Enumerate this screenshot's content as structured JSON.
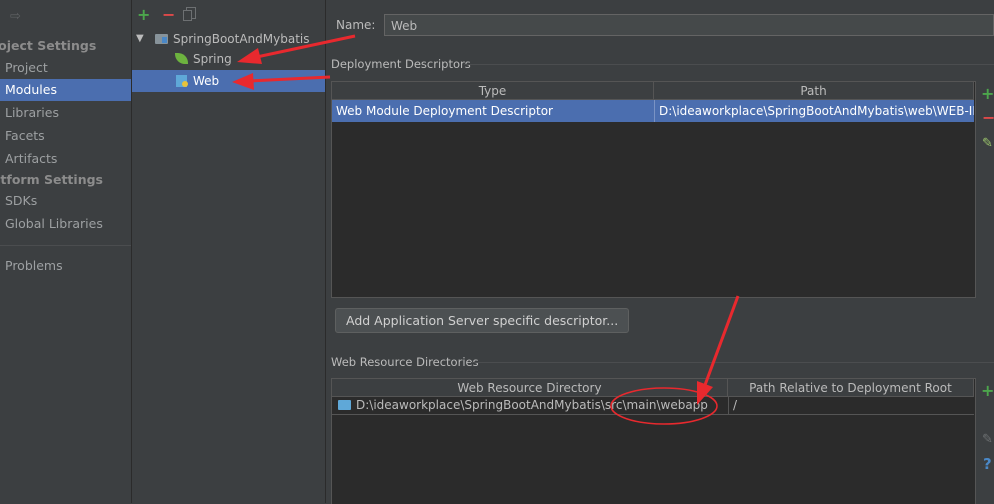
{
  "nav": {
    "back_glyph": "⇨",
    "section_project": "roject Settings",
    "items_project": [
      "Project",
      "Modules",
      "Libraries",
      "Facets",
      "Artifacts"
    ],
    "section_platform": "atform Settings",
    "items_platform": [
      "SDKs",
      "Global Libraries"
    ],
    "problems": "Problems",
    "selected": "Modules"
  },
  "tree": {
    "root": "SpringBootAndMybatis",
    "children": [
      "Spring",
      "Web"
    ],
    "selected": "Web"
  },
  "form": {
    "name_label": "Name:",
    "name_value": "Web"
  },
  "deployment": {
    "title": "Deployment Descriptors",
    "col_type": "Type",
    "col_path": "Path",
    "row_type": "Web Module Deployment Descriptor",
    "row_path": "D:\\ideaworkplace\\SpringBootAndMybatis\\web\\WEB-INF\\web.xml",
    "add_server_button": "Add Application Server specific descriptor..."
  },
  "resources": {
    "title": "Web Resource Directories",
    "col_dir": "Web Resource Directory",
    "col_rel": "Path Relative to Deployment Root",
    "row_dir": "D:\\ideaworkplace\\SpringBootAndMybatis\\src\\main\\webapp",
    "row_rel": "/"
  },
  "colors": {
    "selection": "#4b6eaf",
    "add_green": "#4ca64c",
    "remove_red": "#e04a4a",
    "annotation_red": "#e8292e"
  }
}
